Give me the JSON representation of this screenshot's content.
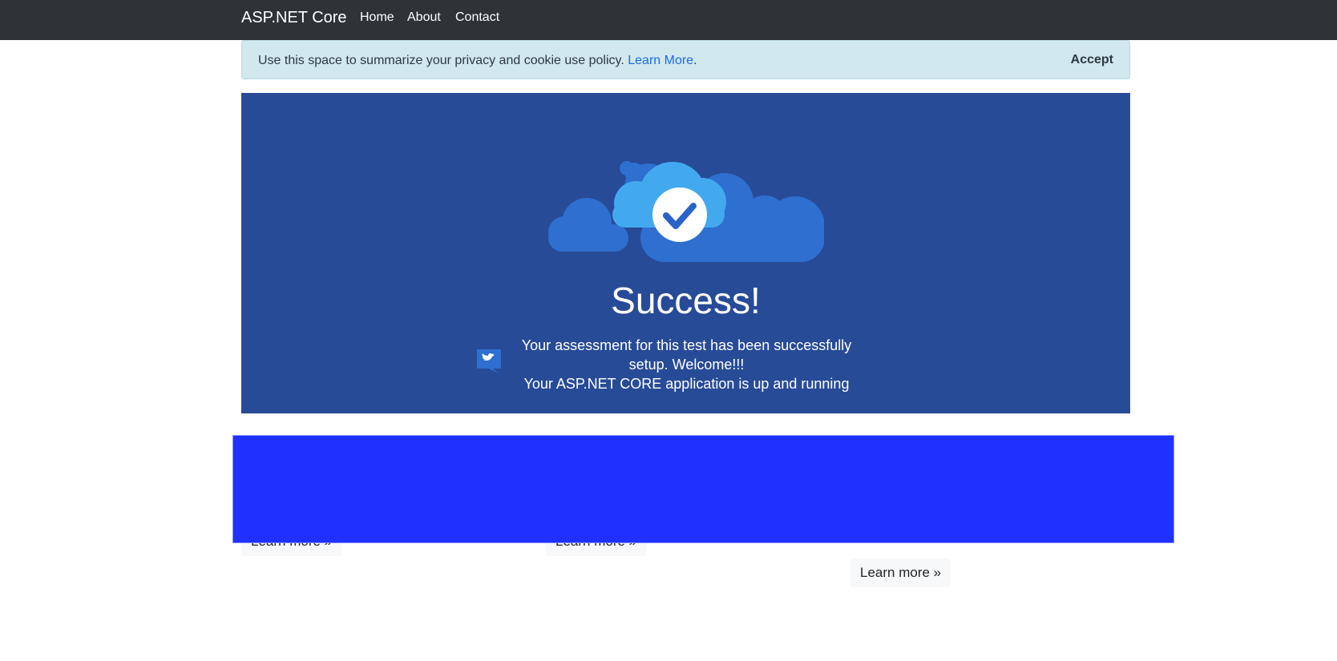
{
  "navbar": {
    "brand": "ASP.NET Core",
    "links": [
      "Home",
      "About",
      "Contact"
    ]
  },
  "cookie_banner": {
    "text": "Use this space to summarize your privacy and cookie use policy.",
    "link_label": "Learn More",
    "trailing": ".",
    "accept_label": "Accept"
  },
  "hero": {
    "title": "Success!",
    "line1": "Your assessment for this test has been successfully setup. Welcome!!!",
    "line2": "Your ASP.NET CORE application is up and running",
    "icons": [
      "cloud-check-icon",
      "twitter-icon"
    ]
  },
  "learn_more": [
    "Learn more »",
    "Learn more »",
    "Learn more »"
  ],
  "colors": {
    "navbar": "#2e3338",
    "hero": "#274b97",
    "cookie_bg": "#d1e8ee",
    "overlay": "#2030ff",
    "link": "#1a6be8"
  }
}
